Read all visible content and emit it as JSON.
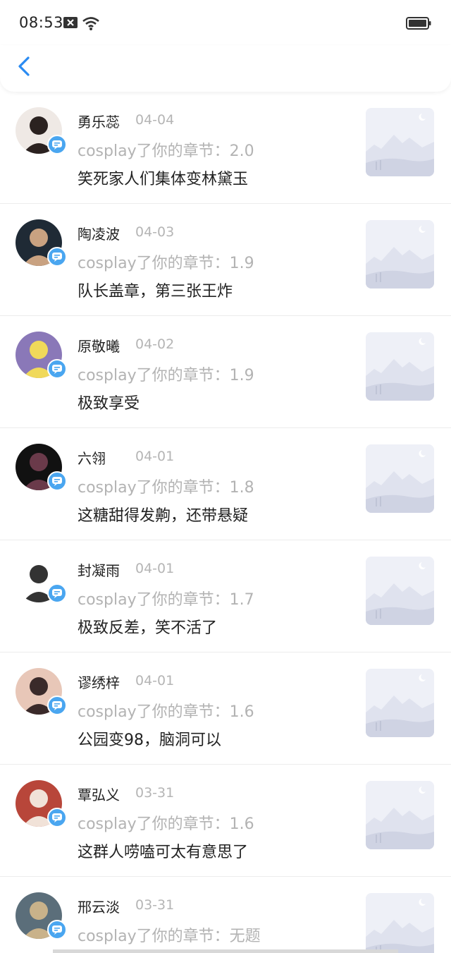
{
  "status_bar": {
    "time": "08:53",
    "icons": [
      "close-notification-icon",
      "wifi-icon",
      "battery-icon"
    ]
  },
  "nav": {
    "back_icon": "chevron-left-icon",
    "accent": "#2a8bf2"
  },
  "badge_color": "#4aa6f0",
  "items": [
    {
      "name": "勇乐蕊",
      "date": "04-04",
      "action": "cosplay了你的章节：2.0",
      "comment": "笑死家人们集体变林黛玉",
      "avatar_colors": [
        "#efe9e5",
        "#2b2220"
      ]
    },
    {
      "name": "陶凌波",
      "date": "04-03",
      "action": "cosplay了你的章节：1.9",
      "comment": "队长盖章，第三张王炸",
      "avatar_colors": [
        "#1f2a35",
        "#c9a281"
      ]
    },
    {
      "name": "原敬曦",
      "date": "04-02",
      "action": "cosplay了你的章节：1.9",
      "comment": "极致享受",
      "avatar_colors": [
        "#8a78b8",
        "#f0d95a"
      ]
    },
    {
      "name": "六翎",
      "date": "04-01",
      "action": "cosplay了你的章节：1.8",
      "comment": "这糖甜得发齁，还带悬疑",
      "avatar_colors": [
        "#111111",
        "#6a3a4a"
      ]
    },
    {
      "name": "封凝雨",
      "date": "04-01",
      "action": "cosplay了你的章节：1.7",
      "comment": "极致反差，笑不活了",
      "avatar_colors": [
        "#ffffff",
        "#333333"
      ]
    },
    {
      "name": "谬绣梓",
      "date": "04-01",
      "action": "cosplay了你的章节：1.6",
      "comment": "公园变98，脑洞可以",
      "avatar_colors": [
        "#e8c7b8",
        "#3a2a2a"
      ]
    },
    {
      "name": "覃弘义",
      "date": "03-31",
      "action": "cosplay了你的章节：1.6",
      "comment": "这群人唠嗑可太有意思了",
      "avatar_colors": [
        "#b8463a",
        "#f1e2d8"
      ]
    },
    {
      "name": "邢云淡",
      "date": "03-31",
      "action": "cosplay了你的章节：无题",
      "comment": "",
      "avatar_colors": [
        "#5b6e7a",
        "#c9b28a"
      ]
    }
  ]
}
